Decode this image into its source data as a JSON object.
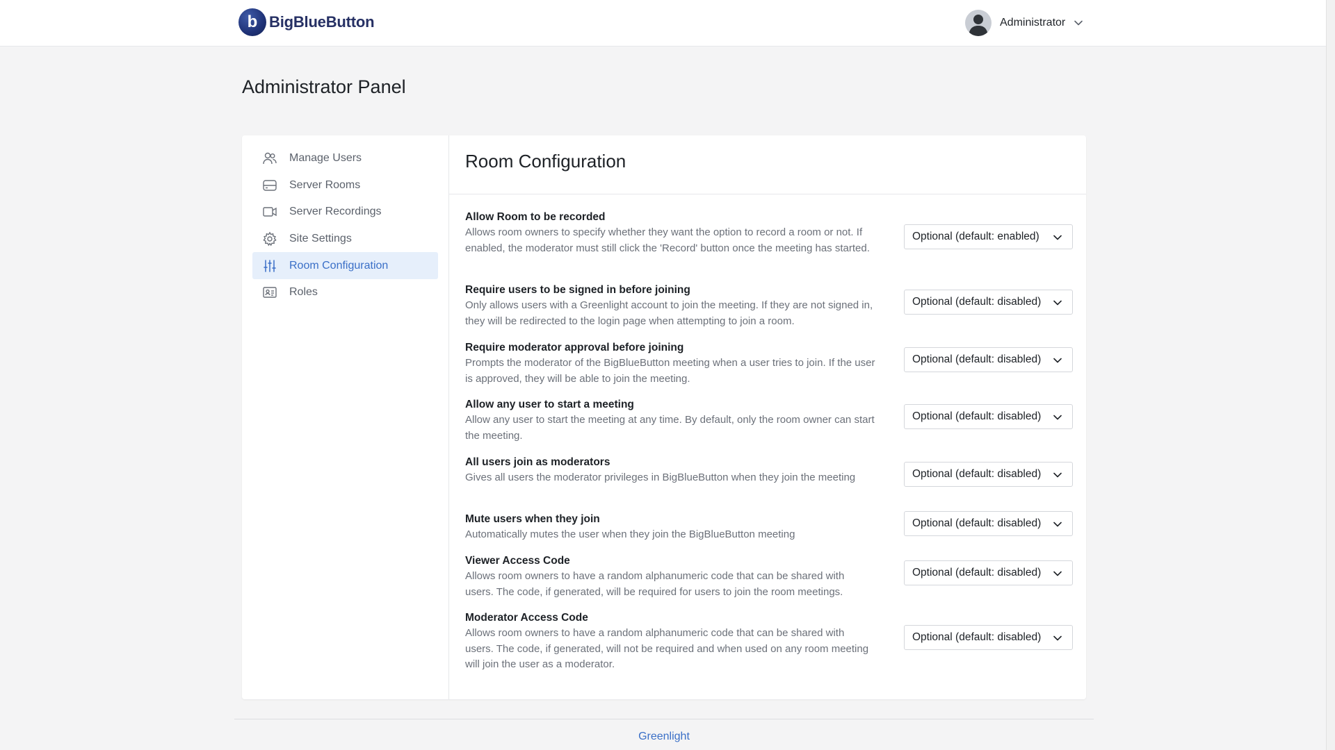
{
  "brand": {
    "name": "BigBlueButton",
    "mark": "b"
  },
  "user_menu": {
    "name": "Administrator",
    "icon": "chevron-down-icon"
  },
  "page": {
    "title": "Administrator Panel"
  },
  "sidebar": {
    "items": [
      {
        "label": "Manage Users",
        "icon": "users-icon"
      },
      {
        "label": "Server Rooms",
        "icon": "server-icon"
      },
      {
        "label": "Server Recordings",
        "icon": "video-icon"
      },
      {
        "label": "Site Settings",
        "icon": "gear-icon"
      },
      {
        "label": "Room Configuration",
        "icon": "sliders-icon",
        "active": true
      },
      {
        "label": "Roles",
        "icon": "id-card-icon"
      }
    ]
  },
  "content": {
    "title": "Room Configuration",
    "settings": [
      {
        "title": "Allow Room to be recorded",
        "description": "Allows room owners to specify whether they want the option to record a room or not. If enabled, the moderator must still click the 'Record' button once the meeting has started.",
        "value": "Optional (default: enabled)"
      },
      {
        "title": "Require users to be signed in before joining",
        "description": "Only allows users with a Greenlight account to join the meeting. If they are not signed in, they will be redirected to the login page when attempting to join a room.",
        "value": "Optional (default: disabled)"
      },
      {
        "title": "Require moderator approval before joining",
        "description": "Prompts the moderator of the BigBlueButton meeting when a user tries to join. If the user is approved, they will be able to join the meeting.",
        "value": "Optional (default: disabled)"
      },
      {
        "title": "Allow any user to start a meeting",
        "description": "Allow any user to start the meeting at any time. By default, only the room owner can start the meeting.",
        "value": "Optional (default: disabled)"
      },
      {
        "title": "All users join as moderators",
        "description": "Gives all users the moderator privileges in BigBlueButton when they join the meeting",
        "value": "Optional (default: disabled)"
      },
      {
        "title": "Mute users when they join",
        "description": "Automatically mutes the user when they join the BigBlueButton meeting",
        "value": "Optional (default: disabled)"
      },
      {
        "title": "Viewer Access Code",
        "description": "Allows room owners to have a random alphanumeric code that can be shared with users. The code, if generated, will be required for users to join the room meetings.",
        "value": "Optional (default: disabled)"
      },
      {
        "title": "Moderator Access Code",
        "description": "Allows room owners to have a random alphanumeric code that can be shared with users. The code, if generated, will not be required and when used on any room meeting will join the user as a moderator.",
        "value": "Optional (default: disabled)"
      }
    ]
  },
  "footer": {
    "link": "Greenlight"
  },
  "colors": {
    "accent": "#3a6fc7",
    "active_bg": "#e6effb",
    "brand": "#263064"
  }
}
